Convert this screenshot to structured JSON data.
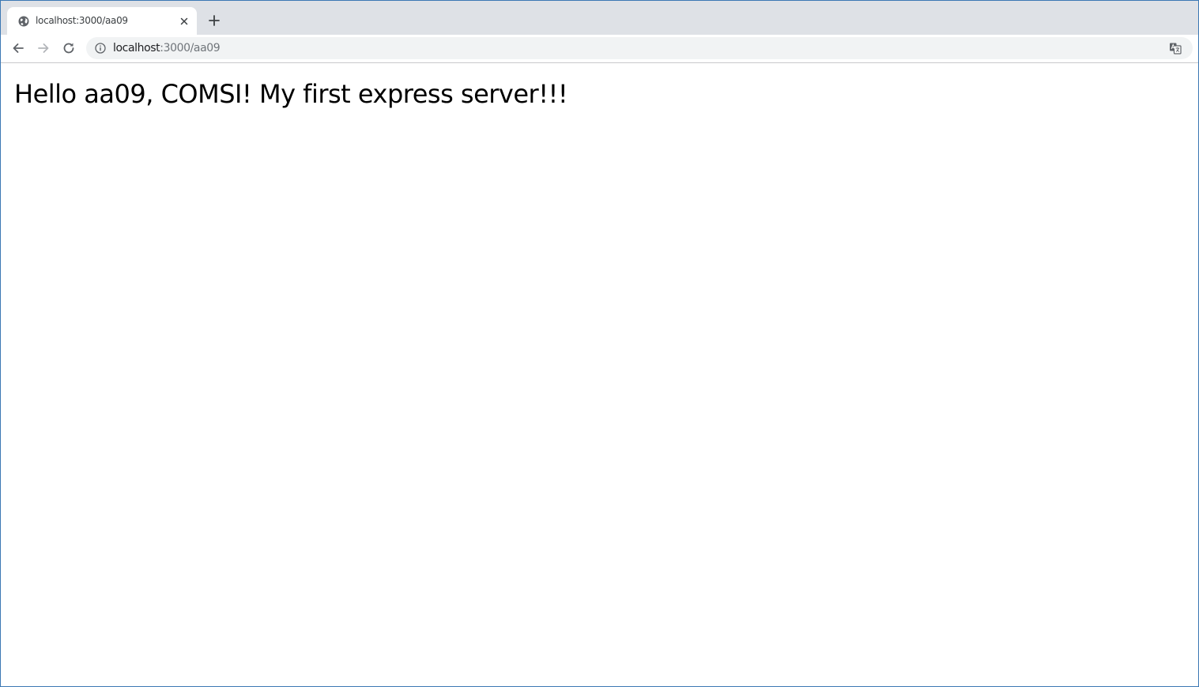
{
  "browser": {
    "tab": {
      "title": "localhost:3000/aa09",
      "favicon": "globe-icon"
    },
    "new_tab_icon": "plus-icon",
    "toolbar": {
      "back_icon": "arrow-left-icon",
      "forward_icon": "arrow-right-icon",
      "reload_icon": "reload-icon",
      "site_info_icon": "info-icon",
      "url_host": "localhost",
      "url_rest": ":3000/aa09",
      "translate_icon": "translate-icon"
    },
    "colors": {
      "tabstrip": "#dee1e6",
      "omnibox": "#f1f3f4",
      "window_border": "#3c78b4"
    }
  },
  "page": {
    "heading": "Hello aa09, COMSI! My first express server!!!"
  }
}
